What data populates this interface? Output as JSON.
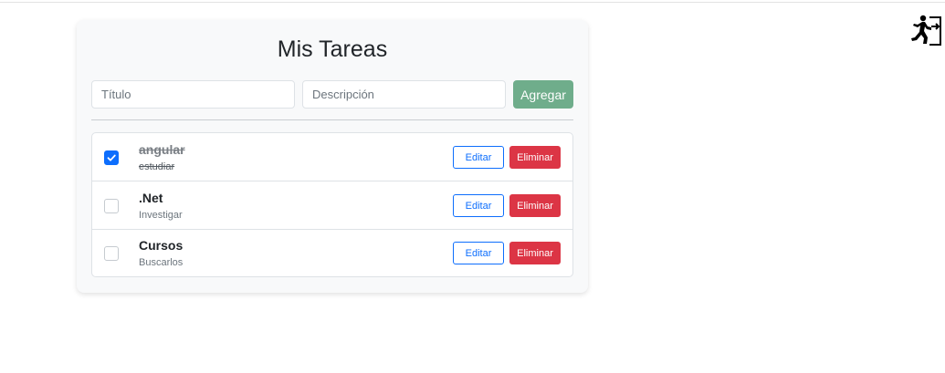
{
  "header": {
    "logout_icon": "running-exit-icon"
  },
  "card": {
    "title": "Mis Tareas",
    "form": {
      "title_placeholder": "Título",
      "description_placeholder": "Descripción",
      "add_label": "Agregar",
      "add_color": "#6fad8b"
    }
  },
  "tasks": [
    {
      "title": "angular",
      "description": "estudiar",
      "completed": true,
      "edit_label": "Editar",
      "delete_label": "Eliminar"
    },
    {
      "title": ".Net",
      "description": "Investigar",
      "completed": false,
      "edit_label": "Editar",
      "delete_label": "Eliminar"
    },
    {
      "title": "Cursos",
      "description": "Buscarlos",
      "completed": false,
      "edit_label": "Editar",
      "delete_label": "Eliminar"
    }
  ],
  "colors": {
    "primary": "#0d6efd",
    "danger": "#dc3545"
  }
}
